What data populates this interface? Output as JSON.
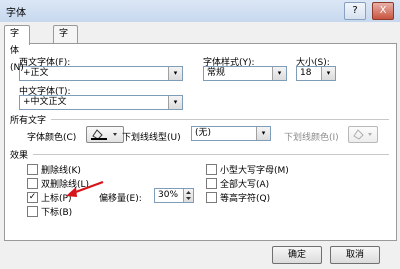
{
  "window": {
    "title": "字体"
  },
  "tabs": [
    {
      "label": "字体(N)"
    },
    {
      "label": "字符间距(R)"
    }
  ],
  "font": {
    "western_label": "西文字体(F):",
    "western_value": "+正文",
    "style_label": "字体样式(Y):",
    "style_value": "常规",
    "size_label": "大小(S):",
    "size_value": "18",
    "chinese_label": "中文字体(T):",
    "chinese_value": "+中文正文"
  },
  "all_text": {
    "heading": "所有文字",
    "color_label": "字体颜色(C)",
    "underline_type_label": "下划线线型(U)",
    "underline_value": "(无)",
    "underline_color_label": "下划线颜色(I)"
  },
  "effects": {
    "heading": "效果",
    "strikethrough": "删除线(K)",
    "double_strikethrough": "双删除线(L)",
    "superscript": "上标(P)",
    "offset_label": "偏移量(E):",
    "offset_value": "30%",
    "subscript": "下标(B)",
    "small_caps": "小型大写字母(M)",
    "all_caps": "全部大写(A)",
    "equalize_height": "等高字符(Q)",
    "superscript_checked": true
  },
  "buttons": {
    "ok": "确定",
    "cancel": "取消"
  },
  "window_controls": {
    "help": "?",
    "close": "X"
  },
  "glyphs": {
    "dropdown": "▾",
    "check": "✓"
  },
  "colors": {
    "accent_arrow": "#d7141a"
  }
}
